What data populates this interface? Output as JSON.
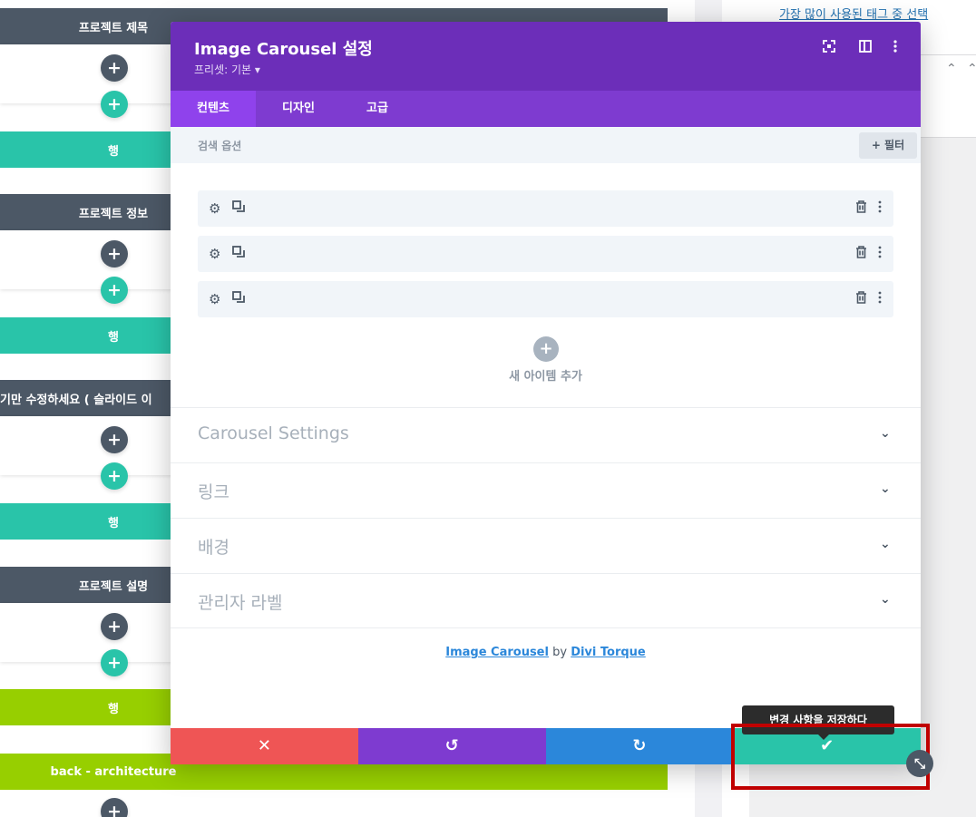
{
  "background": {
    "tags_link": "가장 많이 사용된 태그 중 선택",
    "sections": [
      {
        "title": "프로젝트 제목",
        "row_label": "행",
        "row_color": "teal"
      },
      {
        "title": "프로젝트 정보",
        "row_label": "행",
        "row_color": "teal"
      },
      {
        "title": "기만 수정하세요 ( 슬라이드 이",
        "row_label": "행",
        "row_color": "teal"
      },
      {
        "title": "프로젝트 설명",
        "row_label": "행",
        "row_color": "lime"
      }
    ],
    "last_section": "back - architecture",
    "add_glyph": "+"
  },
  "modal": {
    "title": "Image Carousel 설정",
    "preset": "프리셋: 기본 ▾",
    "header_icons": [
      "expand-icon",
      "sidebar-layout-icon",
      "more-vertical-icon"
    ],
    "tabs": [
      {
        "label": "컨텐츠",
        "active": true
      },
      {
        "label": "디자인",
        "active": false
      },
      {
        "label": "고급",
        "active": false
      }
    ],
    "search": {
      "label": "검색 옵션",
      "filter_button": "+ 필터"
    },
    "items": [
      {
        "id": 1
      },
      {
        "id": 2
      },
      {
        "id": 3
      }
    ],
    "add_item": {
      "glyph": "+",
      "label": "새 아이템 추가"
    },
    "accordions": [
      {
        "title": "Carousel Settings"
      },
      {
        "title": "링크"
      },
      {
        "title": "배경"
      },
      {
        "title": "관리자 라벨"
      }
    ],
    "credit": {
      "module": "Image Carousel",
      "by": " by ",
      "author": "Divi Torque"
    }
  },
  "footer": {
    "cancel": "✕",
    "undo": "↺",
    "redo": "↻",
    "save": "✔",
    "tooltip": "변경 사항을 저장하다"
  },
  "colors": {
    "header_purple": "#6c2eb9",
    "tab_purple": "#7e3bd0",
    "teal": "#29c4a9",
    "lime": "#97cf00",
    "dark_slate": "#4c5866",
    "red": "#ef5555",
    "blue": "#2b87da",
    "highlight": "#c00000"
  }
}
